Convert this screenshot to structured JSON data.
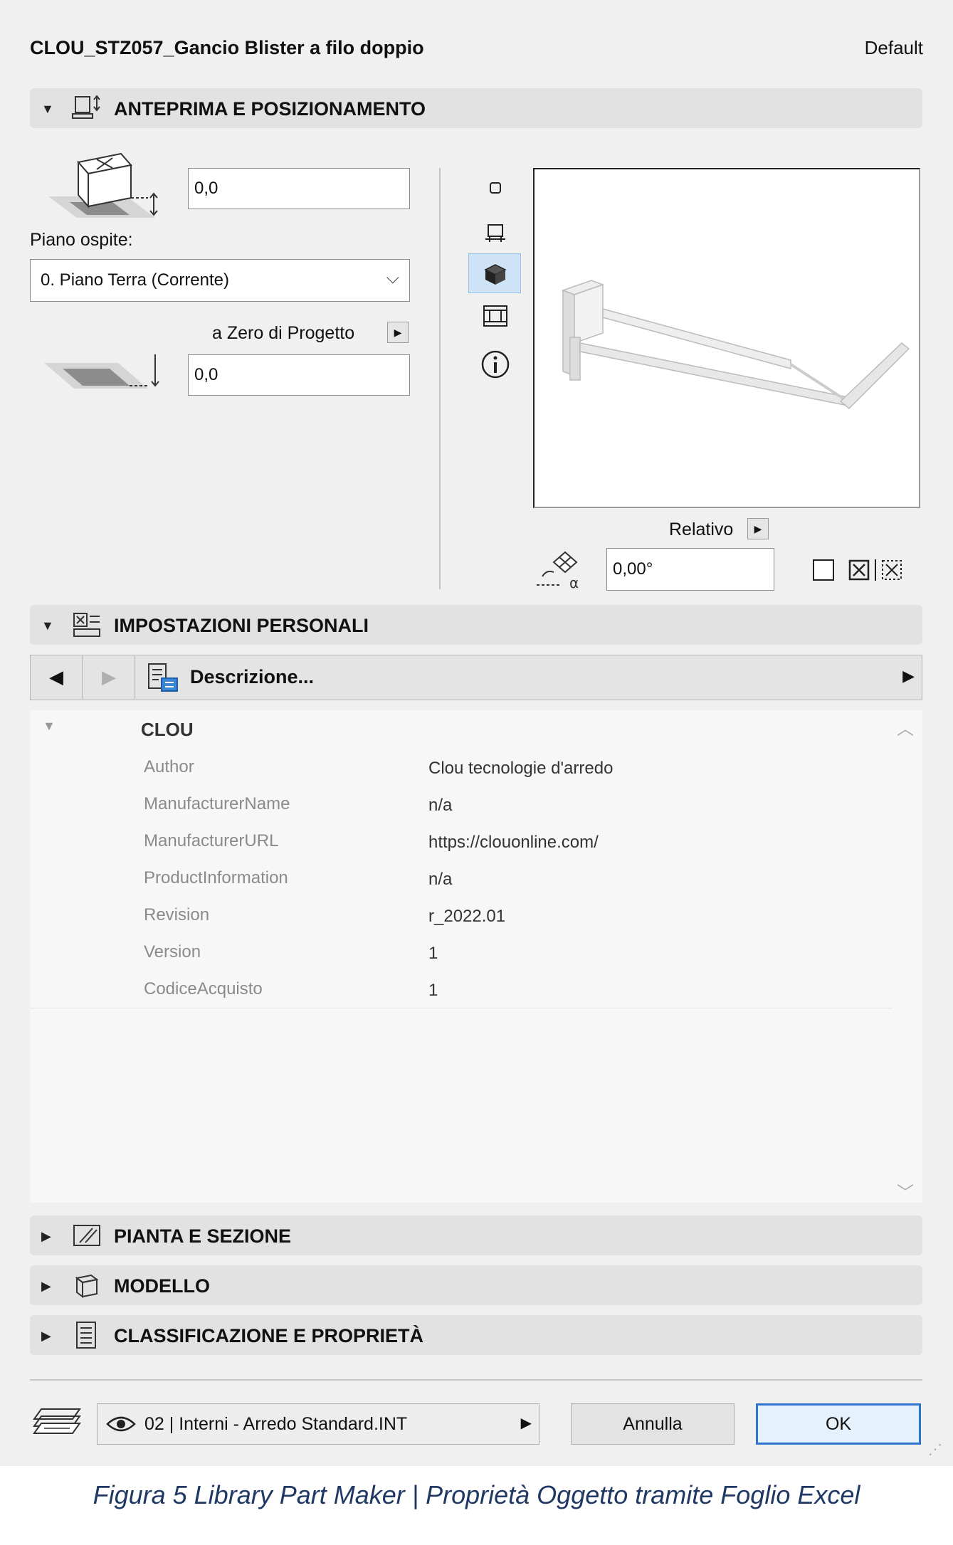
{
  "window": {
    "title": "CLOU_STZ057_Gancio Blister a filo doppio",
    "preset": "Default"
  },
  "sections": {
    "anteprima": "ANTEPRIMA E POSIZIONAMENTO",
    "impostazioni": "IMPOSTAZIONI PERSONALI",
    "pianta": "PIANTA E SEZIONE",
    "modello": "MODELLO",
    "classificazione": "CLASSIFICAZIONE E PROPRIETÀ"
  },
  "positioning": {
    "offset_value": "0,0",
    "home_story_label": "Piano ospite:",
    "home_story_value": "0. Piano Terra (Corrente)",
    "reference_label": "a Zero di Progetto",
    "elevation_value": "0,0",
    "relative_label": "Relativo",
    "angle_value": "0,00°"
  },
  "custom_settings": {
    "page_label": "Descrizione...",
    "group_name": "CLOU",
    "params": [
      {
        "key": "Author",
        "value": "Clou tecnologie d'arredo"
      },
      {
        "key": "ManufacturerName",
        "value": "n/a"
      },
      {
        "key": "ManufacturerURL",
        "value": "https://clouonline.com/"
      },
      {
        "key": "ProductInformation",
        "value": "n/a"
      },
      {
        "key": "Revision",
        "value": "r_2022.01"
      },
      {
        "key": "Version",
        "value": "1"
      },
      {
        "key": "CodiceAcquisto",
        "value": "1"
      }
    ]
  },
  "footer": {
    "layer_value": "02 | Interni - Arredo Standard.INT",
    "cancel_label": "Annulla",
    "ok_label": "OK"
  },
  "caption": "Figura 5 Library Part Maker | Proprietà Oggetto tramite Foglio Excel",
  "colors": {
    "dialog_bg": "#f0f0f0",
    "section_bg": "#e2e2e2",
    "selected_view": "#cfe3f7",
    "ok_border": "#2f74d0",
    "caption": "#1f3864"
  }
}
